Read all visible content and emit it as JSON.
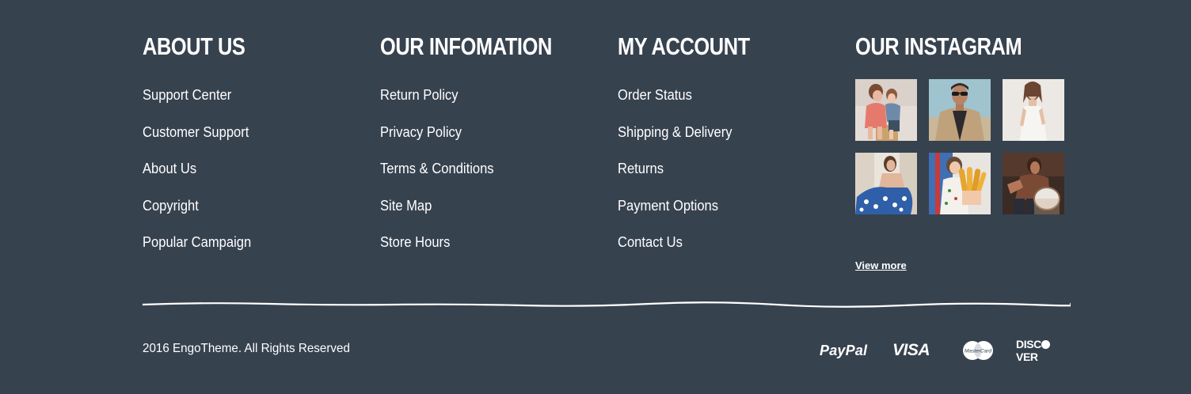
{
  "columns": [
    {
      "heading": "ABOUT US",
      "links": [
        "Support Center",
        "Customer Support",
        "About Us",
        "Copyright",
        "Popular Campaign"
      ]
    },
    {
      "heading": "OUR INFOMATION",
      "links": [
        "Return Policy",
        "Privacy Policy",
        "Terms & Conditions",
        "Site Map",
        "Store Hours"
      ]
    },
    {
      "heading": "MY ACCOUNT",
      "links": [
        "Order Status",
        "Shipping & Delivery",
        "Returns",
        "Payment Options",
        "Contact Us"
      ]
    }
  ],
  "instagram": {
    "heading": "OUR INSTAGRAM",
    "photos": [
      {
        "name": "girl-kissing-boy-photo"
      },
      {
        "name": "man-in-sunglasses-photo"
      },
      {
        "name": "woman-in-white-photo"
      },
      {
        "name": "woman-in-blue-dress-photo"
      },
      {
        "name": "boy-with-bread-photo"
      },
      {
        "name": "man-with-drum-photo"
      }
    ],
    "view_more": "View more"
  },
  "footer": {
    "copyright": "2016 EngoTheme. All Rights Reserved"
  },
  "payments": {
    "paypal": "PayPal",
    "visa": "VISA",
    "mastercard": "MasterCard",
    "discover_left": "DISC",
    "discover_right": "VER"
  },
  "colors": {
    "background": "#37424f",
    "text": "#ffffff"
  }
}
